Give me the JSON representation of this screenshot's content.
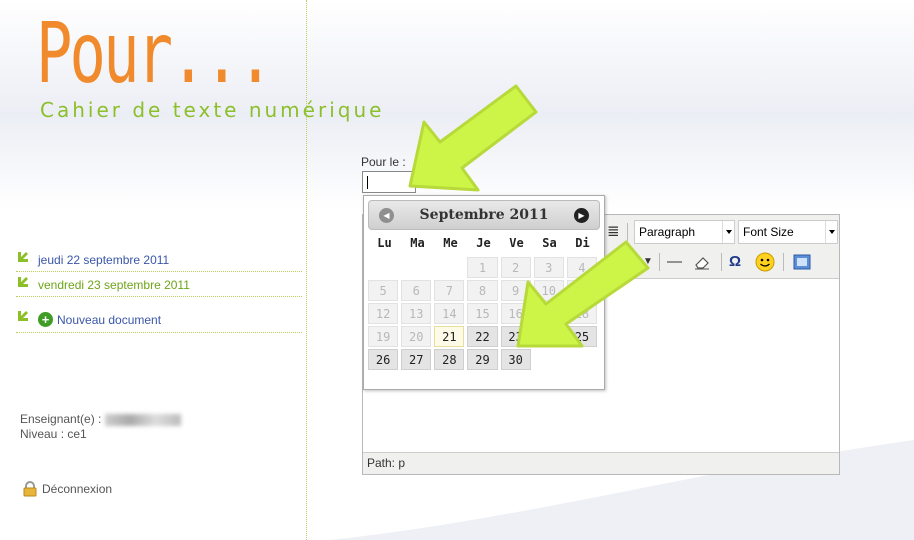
{
  "logo": {
    "title": "Pour...",
    "subtitle": "Cahier de texte numérique"
  },
  "sidebar": {
    "items": [
      {
        "label": "jeudi 22 septembre 2011"
      },
      {
        "label": "vendredi 23 septembre 2011"
      }
    ],
    "new_document": "Nouveau document",
    "teacher_label": "Enseignant(e) :",
    "level": "Niveau : ce1",
    "logout": "Déconnexion"
  },
  "form": {
    "date_label": "Pour le :",
    "date_value": ""
  },
  "editor": {
    "format_select": "Paragraph",
    "font_size_select": "Font Size",
    "status_path": "Path: p"
  },
  "calendar": {
    "title": "Septembre 2011",
    "weekdays": [
      "Lu",
      "Ma",
      "Me",
      "Je",
      "Ve",
      "Sa",
      "Di"
    ],
    "weeks": [
      [
        "",
        "",
        "",
        "1",
        "2",
        "3",
        "4"
      ],
      [
        "5",
        "6",
        "7",
        "8",
        "9",
        "10",
        "11"
      ],
      [
        "12",
        "13",
        "14",
        "15",
        "16",
        "17",
        "18"
      ],
      [
        "19",
        "20",
        "21",
        "22",
        "23",
        "24",
        "25"
      ],
      [
        "26",
        "27",
        "28",
        "29",
        "30",
        "",
        ""
      ]
    ],
    "today": "21"
  },
  "colors": {
    "logo_orange": "#f08a2c",
    "accent_green": "#8cbf2a",
    "annotation_arrow": "#ccf548",
    "link_blue": "#3a56a8"
  },
  "icons": [
    "align-justify-icon",
    "dropdown-arrow-icon",
    "horizontal-rule-icon",
    "eraser-icon",
    "special-char-icon",
    "emoticon-icon",
    "media-icon",
    "lock-icon",
    "add-icon",
    "prev-month-icon",
    "next-month-icon"
  ]
}
